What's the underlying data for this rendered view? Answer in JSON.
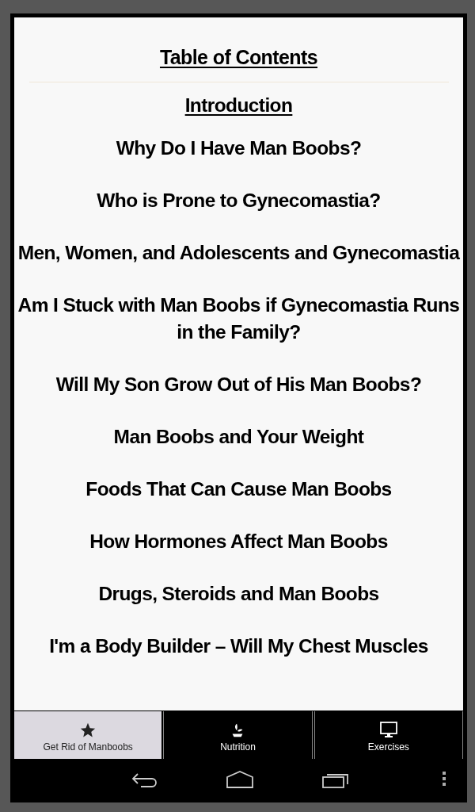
{
  "title": "Table of Contents",
  "items": [
    {
      "label": "Introduction",
      "underlined": true
    },
    {
      "label": "Why Do I Have Man Boobs?",
      "underlined": false
    },
    {
      "label": "Who is Prone to Gynecomastia?",
      "underlined": false
    },
    {
      "label": "Men, Women, and Adolescents and Gynecomastia",
      "underlined": false
    },
    {
      "label": "Am I Stuck with Man Boobs if Gynecomastia Runs in the Family?",
      "underlined": false
    },
    {
      "label": "Will My Son Grow Out of His Man Boobs?",
      "underlined": false
    },
    {
      "label": "Man Boobs and Your Weight",
      "underlined": false
    },
    {
      "label": "Foods That Can Cause Man Boobs",
      "underlined": false
    },
    {
      "label": "How Hormones Affect Man Boobs",
      "underlined": false
    },
    {
      "label": "Drugs, Steroids and Man Boobs",
      "underlined": false
    },
    {
      "label": "I'm a Body Builder – Will My Chest Muscles",
      "underlined": false
    }
  ],
  "tabs": [
    {
      "label": "Get Rid of Manboobs",
      "kind": "star",
      "selected": true
    },
    {
      "label": "Nutrition",
      "kind": "plant",
      "selected": false
    },
    {
      "label": "Exercises",
      "kind": "monitor",
      "selected": false
    }
  ]
}
